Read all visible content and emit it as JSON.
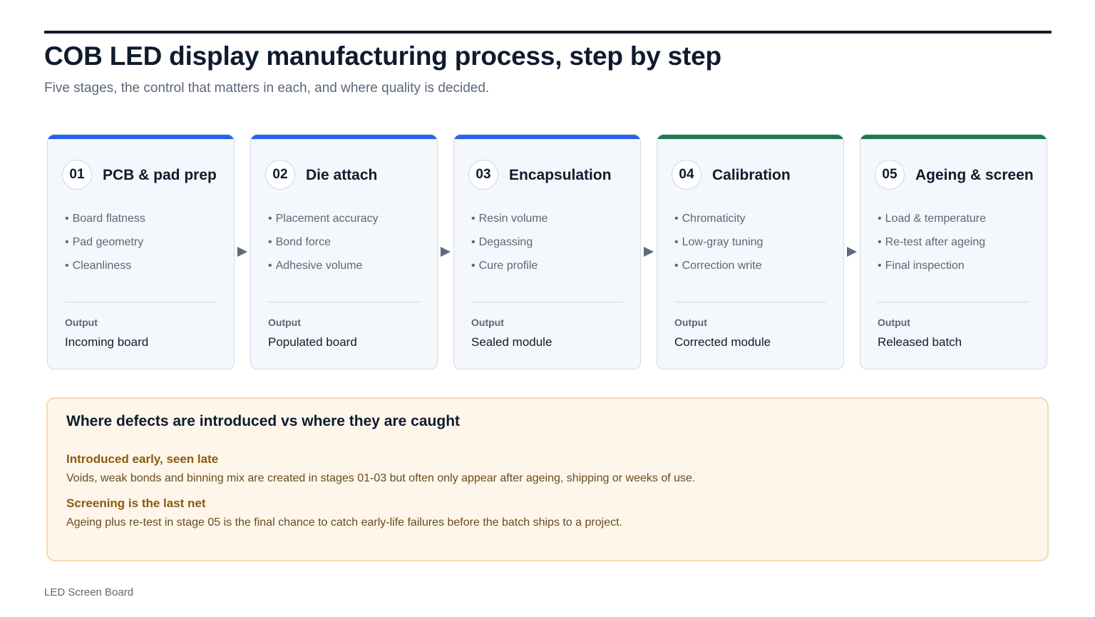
{
  "header": {
    "title": "COB LED display manufacturing process, step by step",
    "subtitle": "Five stages, the control that matters in each, and where quality is decided."
  },
  "stages": [
    {
      "number": "01",
      "name": "PCB & pad prep",
      "accent": "#2563eb",
      "controls": [
        "Board flatness",
        "Pad geometry",
        "Cleanliness"
      ],
      "output_label": "Output",
      "output": "Incoming board"
    },
    {
      "number": "02",
      "name": "Die attach",
      "accent": "#2563eb",
      "controls": [
        "Placement accuracy",
        "Bond force",
        "Adhesive volume"
      ],
      "output_label": "Output",
      "output": "Populated board"
    },
    {
      "number": "03",
      "name": "Encapsulation",
      "accent": "#2563eb",
      "controls": [
        "Resin volume",
        "Degassing",
        "Cure profile"
      ],
      "output_label": "Output",
      "output": "Sealed module"
    },
    {
      "number": "04",
      "name": "Calibration",
      "accent": "#1f7a4d",
      "controls": [
        "Chromaticity",
        "Low-gray tuning",
        "Correction write"
      ],
      "output_label": "Output",
      "output": "Corrected module"
    },
    {
      "number": "05",
      "name": "Ageing & screen",
      "accent": "#1f7a4d",
      "controls": [
        "Load & temperature",
        "Re-test after ageing",
        "Final inspection"
      ],
      "output_label": "Output",
      "output": "Released batch"
    }
  ],
  "defects": {
    "title": "Where defects are introduced vs where they are caught",
    "points": [
      {
        "title": "Introduced early, seen late",
        "text": "Voids, weak bonds and binning mix are created in stages 01-03 but often only appear after ageing, shipping or weeks of use."
      },
      {
        "title": "Screening is the last net",
        "text": "Ageing plus re-test in stage 05 is the final chance to catch early-life failures before the batch ships to a project."
      }
    ]
  },
  "footer": {
    "source": "LED Screen Board"
  },
  "colors": {
    "accent_blue": "#2563eb",
    "accent_green": "#1f7a4d",
    "callout_background": "#fef6ea",
    "callout_heading": "#8a5a12"
  }
}
